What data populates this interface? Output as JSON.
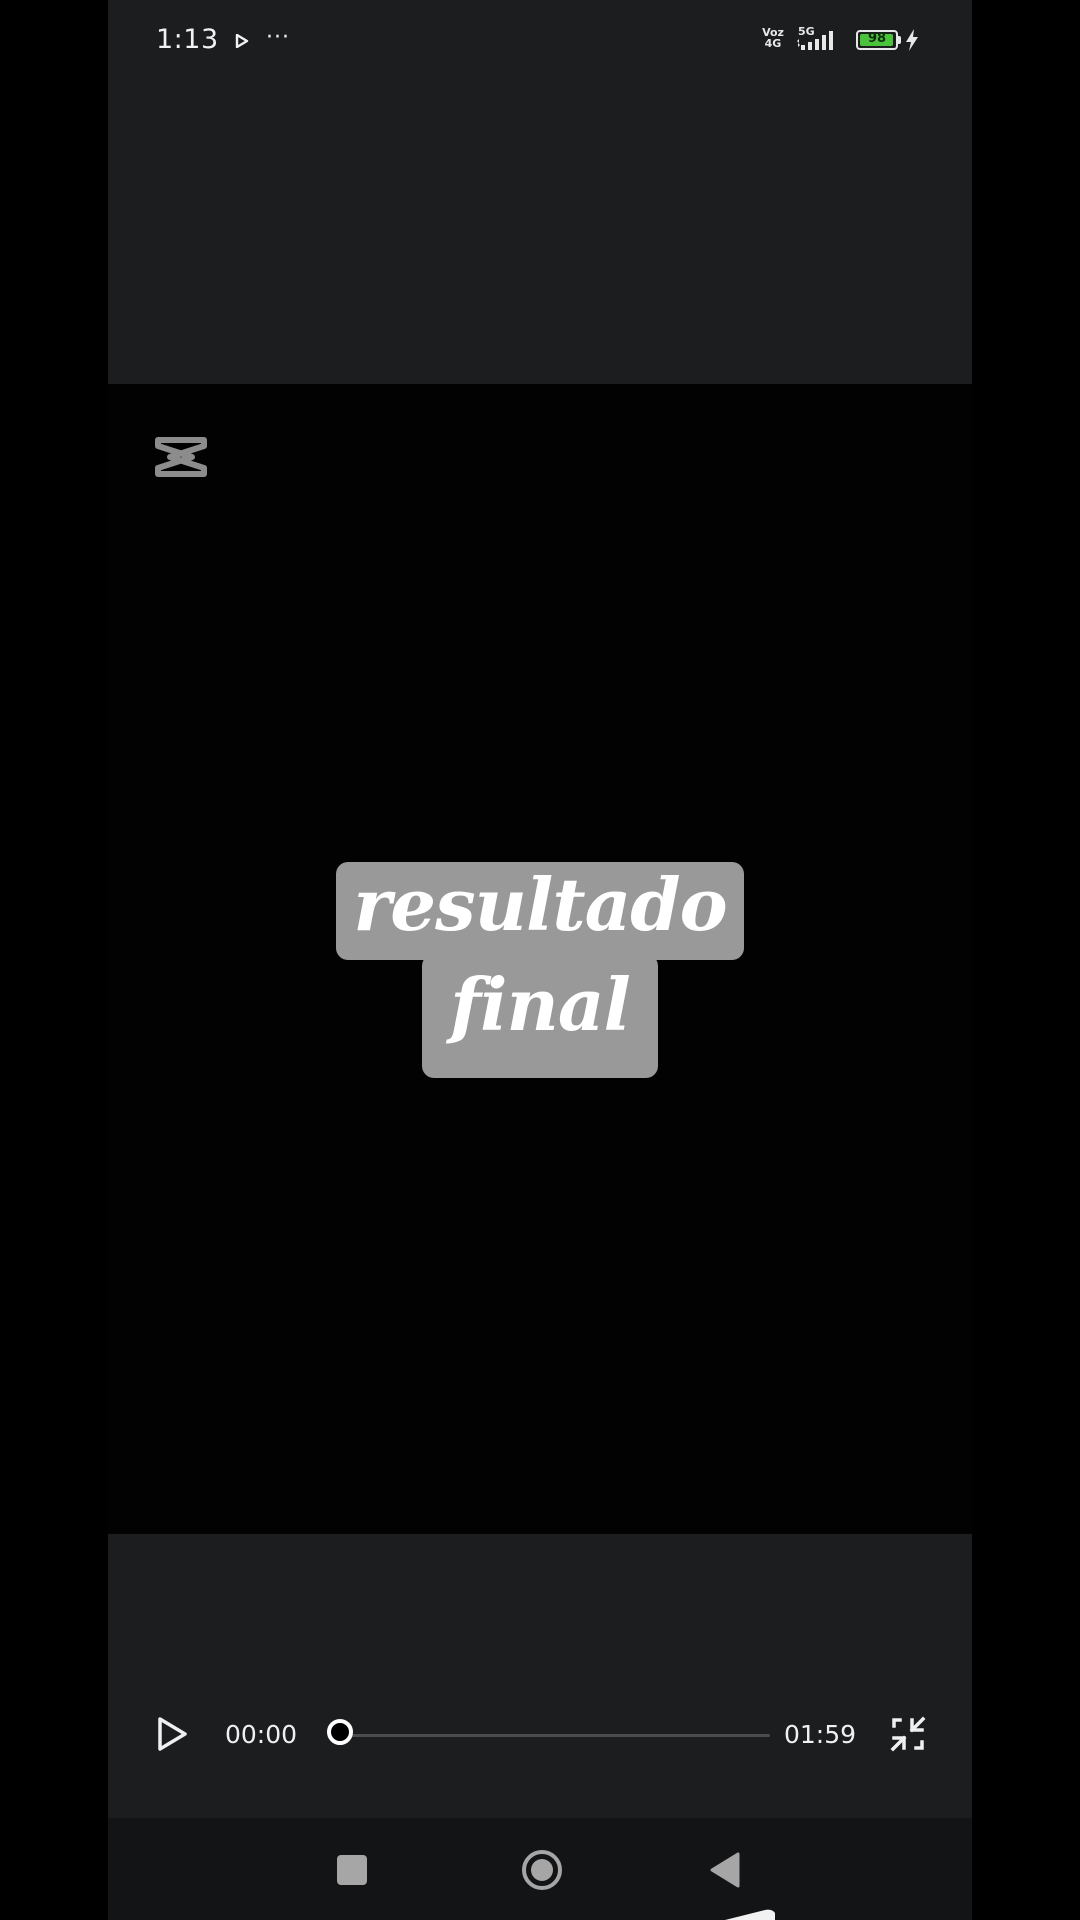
{
  "status_bar": {
    "time": "1:13",
    "more_indicator": "···",
    "volte_label": "Voz 4G",
    "network_label": "5G",
    "battery_level": "98",
    "battery_percent": 98,
    "battery_color": "#49c33a",
    "icons": [
      "media-play-icon",
      "more-dots-icon",
      "signal-icon",
      "battery-icon",
      "charging-icon"
    ]
  },
  "video": {
    "watermark_icon": "capcut-logo-icon",
    "caption_line_1": "resultado",
    "caption_line_2": "final",
    "caption_bg_color": "#999999"
  },
  "player": {
    "current_time": "00:00",
    "total_time": "01:59",
    "progress_fraction": 0.0,
    "play_icon": "play-icon",
    "exit_fullscreen_icon": "exit-fullscreen-icon"
  },
  "nav_bar": {
    "icons": [
      "recents-square-icon",
      "home-circle-icon",
      "back-triangle-icon"
    ]
  }
}
